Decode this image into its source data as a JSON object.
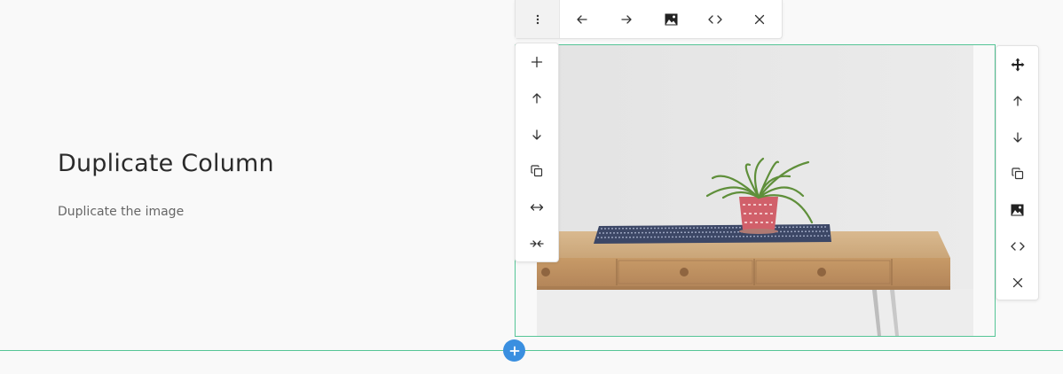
{
  "content": {
    "heading": "Duplicate Column",
    "subtext": "Duplicate the image"
  },
  "top_toolbar": {
    "buttons": [
      {
        "icon": "more-vertical-icon"
      },
      {
        "icon": "arrow-left-icon"
      },
      {
        "icon": "arrow-right-icon"
      },
      {
        "icon": "image-icon"
      },
      {
        "icon": "code-icon"
      },
      {
        "icon": "close-icon"
      }
    ]
  },
  "left_toolbar": {
    "buttons": [
      {
        "icon": "plus-icon"
      },
      {
        "icon": "arrow-up-icon"
      },
      {
        "icon": "arrow-down-icon"
      },
      {
        "icon": "duplicate-icon"
      },
      {
        "icon": "expand-horizontal-icon"
      },
      {
        "icon": "collapse-horizontal-icon"
      }
    ]
  },
  "right_toolbar": {
    "buttons": [
      {
        "icon": "move-icon"
      },
      {
        "icon": "arrow-up-icon"
      },
      {
        "icon": "arrow-down-icon"
      },
      {
        "icon": "duplicate-icon"
      },
      {
        "icon": "image-icon"
      },
      {
        "icon": "code-icon"
      },
      {
        "icon": "close-icon"
      }
    ]
  },
  "colors": {
    "selection_outline": "#55c596",
    "add_button": "#3a8fe0",
    "heading_text": "#2b2b2b",
    "sub_text": "#666666"
  }
}
